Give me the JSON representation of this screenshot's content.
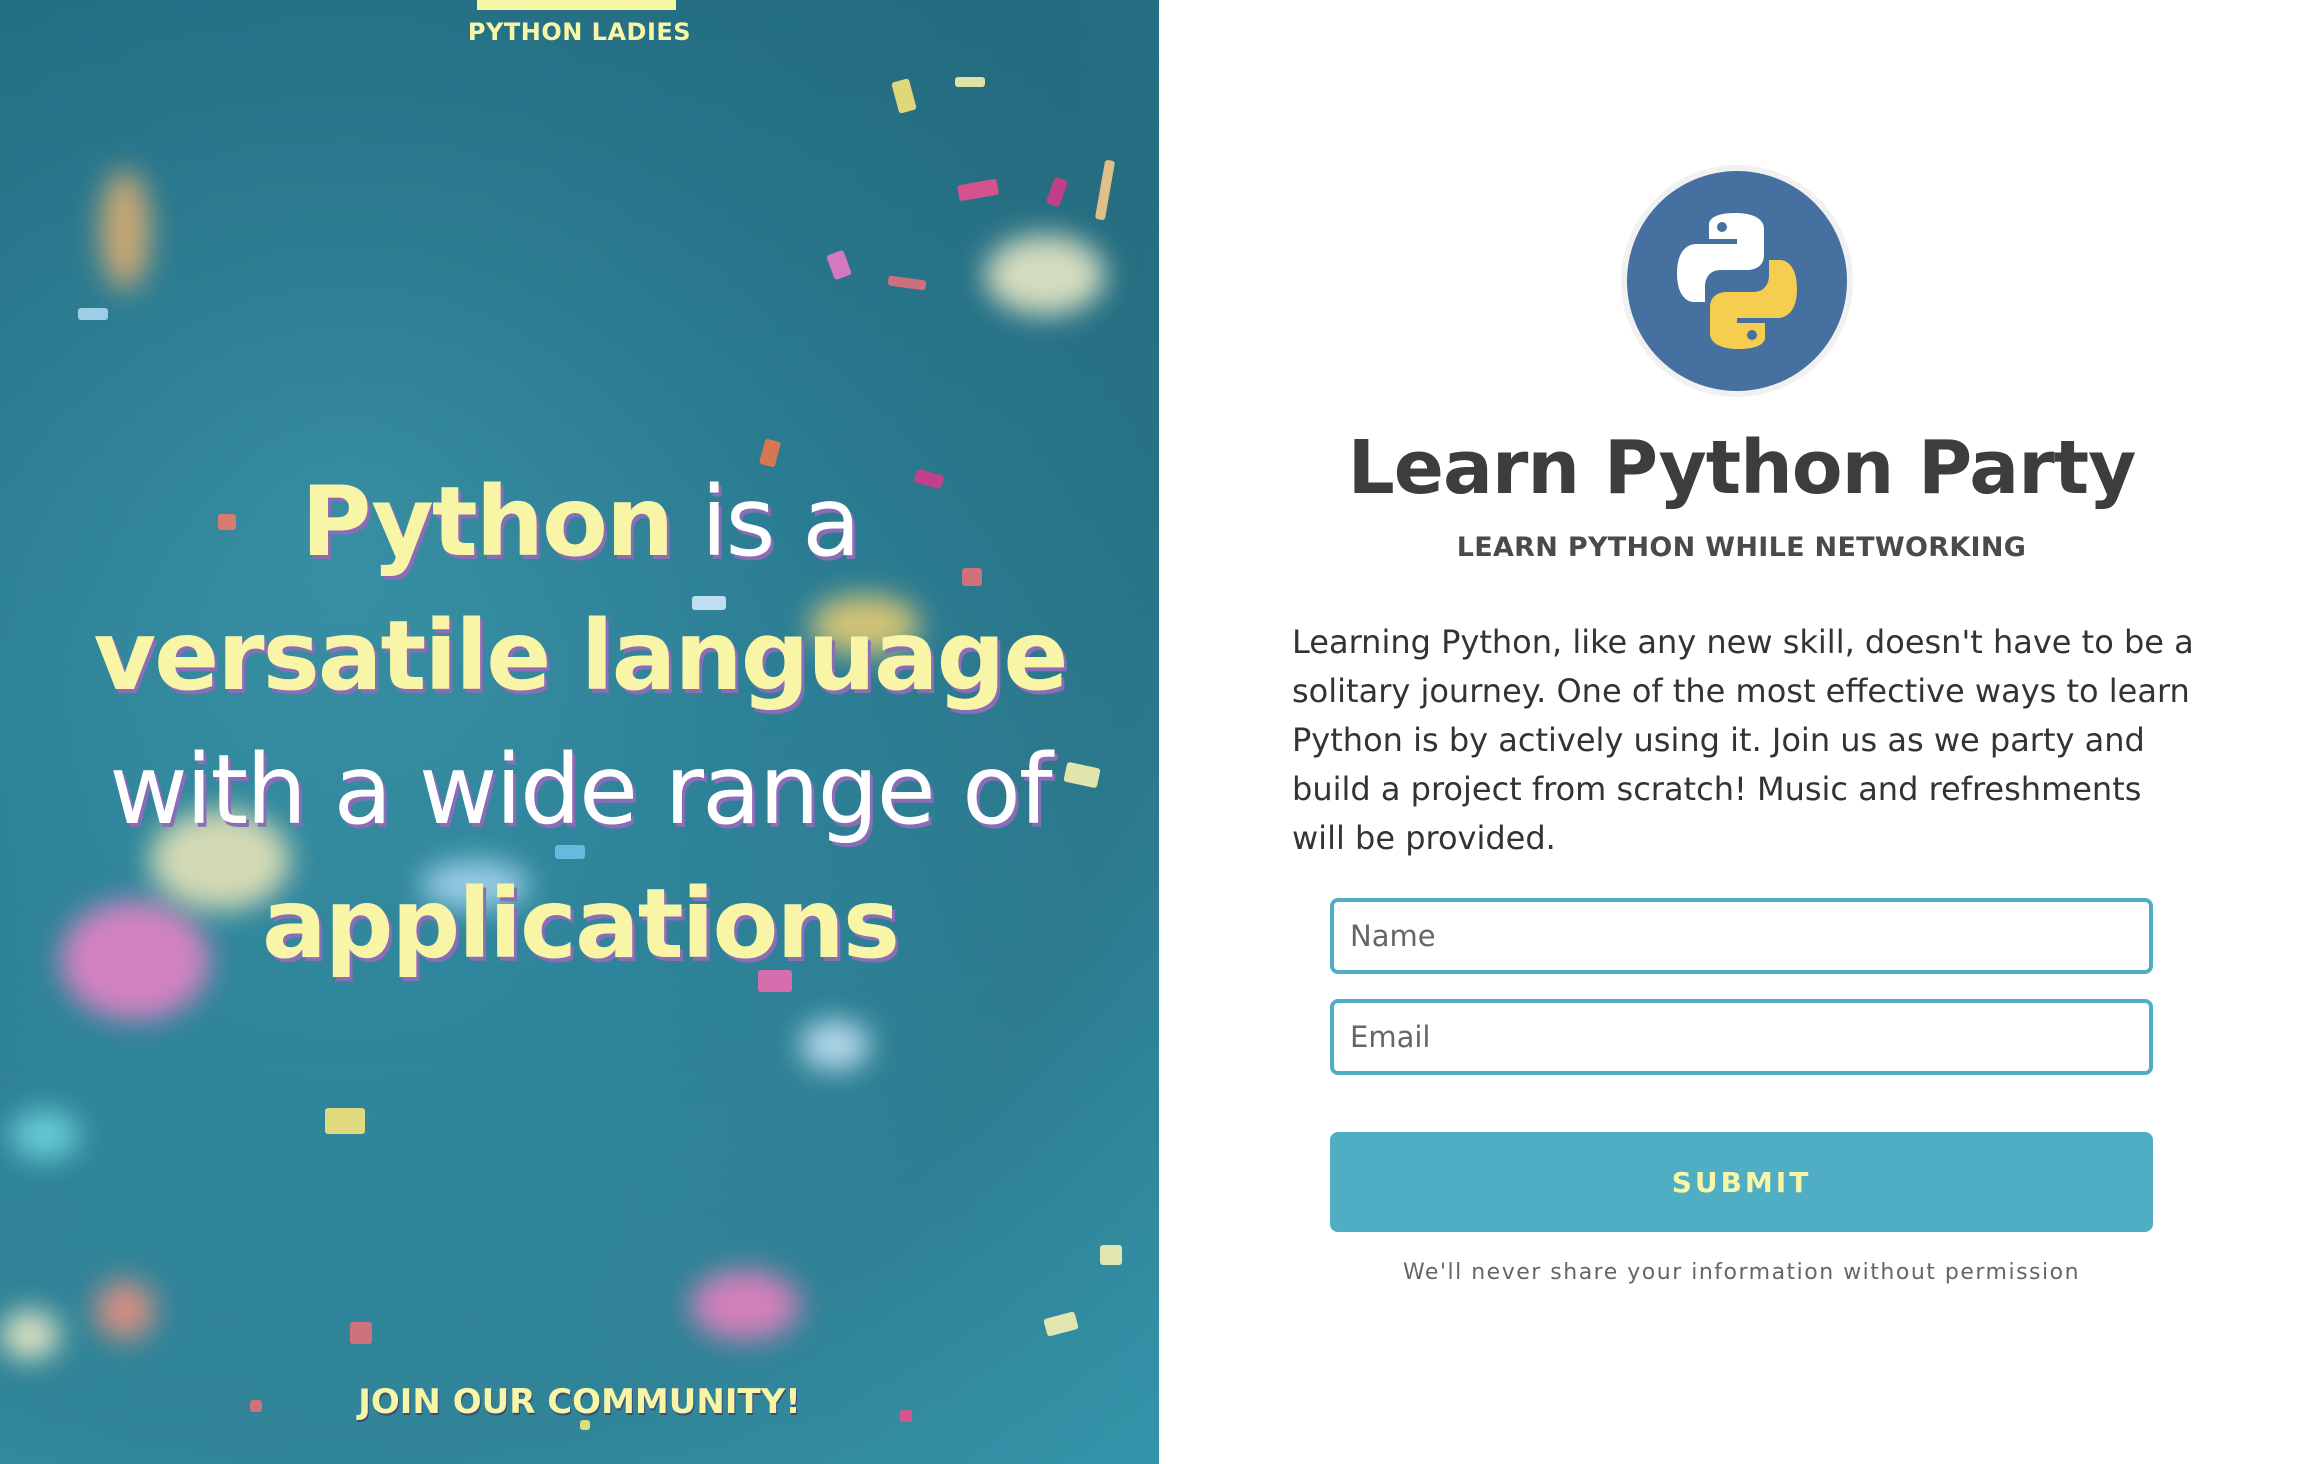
{
  "hero": {
    "brand": "PYTHON LADIES",
    "headline": {
      "line1_highlight": "Python",
      "line1_rest": " is a",
      "line2_highlight": "versatile language",
      "line3": "with a wide range of",
      "line4_highlight": "applications"
    },
    "join_link": "JOIN OUR COMMUNITY!"
  },
  "panel": {
    "logo_icon": "python-logo-icon",
    "title": "Learn Python Party",
    "subtitle": "LEARN PYTHON WHILE NETWORKING",
    "intro": "Learning Python, like any new skill, doesn't have to be a solitary journey. One of the most effective ways to learn Python is by actively using it. Join us as we party and build a project from scratch! Music and refreshments will be provided.",
    "form": {
      "name_placeholder": "Name",
      "name_value": "",
      "email_placeholder": "Email",
      "email_value": "",
      "submit_label": "SUBMIT"
    },
    "privacy_note": "We'll never share your information without permission"
  },
  "colors": {
    "accent": "#4faec4",
    "highlight_yellow": "#f8f6a6",
    "python_blue": "#45709f",
    "python_yellow": "#f5ce4f",
    "heading_text": "#3d3d3d"
  }
}
